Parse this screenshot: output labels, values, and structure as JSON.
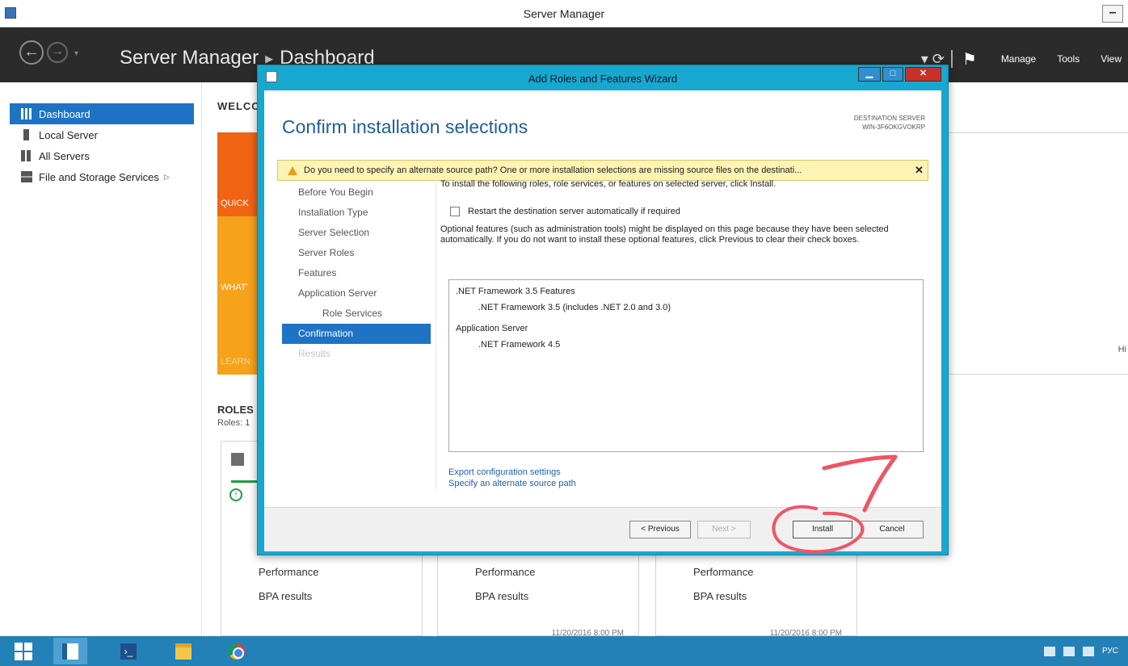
{
  "server_manager": {
    "title": "Server Manager",
    "minimize_glyph": "–",
    "breadcrumb": {
      "root": "Server Manager",
      "separator": "▸",
      "current": "Dashboard"
    },
    "header_menu": {
      "manage": "Manage",
      "tools": "Tools",
      "view": "View"
    },
    "sidebar": {
      "items": [
        {
          "label": "Dashboard",
          "icon": "dashboard-icon"
        },
        {
          "label": "Local Server",
          "icon": "server-icon"
        },
        {
          "label": "All Servers",
          "icon": "servers-icon"
        },
        {
          "label": "File and Storage Services",
          "icon": "storage-icon"
        }
      ]
    },
    "content": {
      "welcome": "WELCO",
      "tiles": {
        "quick": "QUICK",
        "whats": "WHAT'",
        "learn": "LEARN"
      },
      "right_panel_text": "Hi",
      "roles_heading": "ROLES",
      "roles_count": "Roles: 1",
      "cards": [
        {
          "performance": "Performance",
          "bpa": "BPA results",
          "date": ""
        },
        {
          "performance": "Performance",
          "bpa": "BPA results",
          "date": "11/20/2016 8:00 PM"
        },
        {
          "performance": "Performance",
          "bpa": "BPA results",
          "date": "11/20/2016 8:00 PM"
        }
      ]
    }
  },
  "wizard": {
    "title": "Add Roles and Features Wizard",
    "heading": "Confirm installation selections",
    "destination_label": "DESTINATION SERVER",
    "destination_name": "WIN-3F6OKGVOKRP",
    "warning": "Do you need to specify an alternate source path? One or more installation selections are missing source files on the destinati...",
    "warning_close": "✕",
    "nav": [
      {
        "label": "Before You Begin",
        "state": "normal"
      },
      {
        "label": "Installation Type",
        "state": "normal"
      },
      {
        "label": "Server Selection",
        "state": "normal"
      },
      {
        "label": "Server Roles",
        "state": "normal"
      },
      {
        "label": "Features",
        "state": "normal"
      },
      {
        "label": "Application Server",
        "state": "normal"
      },
      {
        "label": "Role Services",
        "state": "sub"
      },
      {
        "label": "Confirmation",
        "state": "active"
      },
      {
        "label": "Results",
        "state": "disabled"
      }
    ],
    "intro": "To install the following roles, role services, or features on selected server, click Install.",
    "restart_label": "Restart the destination server automatically if required",
    "restart_checked": false,
    "optional_text": "Optional features (such as administration tools) might be displayed on this page because they have been selected automatically. If you do not want to install these optional features, click Previous to clear their check boxes.",
    "selections": [
      {
        "group": ".NET Framework 3.5 Features",
        "items": [
          ".NET Framework 3.5 (includes .NET 2.0 and 3.0)"
        ]
      },
      {
        "group": "Application Server",
        "items": [
          ".NET Framework 4.5"
        ]
      }
    ],
    "links": {
      "export": "Export configuration settings",
      "alternate": "Specify an alternate source path"
    },
    "buttons": {
      "previous": "< Previous",
      "next": "Next >",
      "install": "Install",
      "cancel": "Cancel"
    }
  },
  "taskbar": {
    "tray_lang": "РУС"
  },
  "annotation": {
    "number": "7",
    "color": "#ee5566"
  }
}
